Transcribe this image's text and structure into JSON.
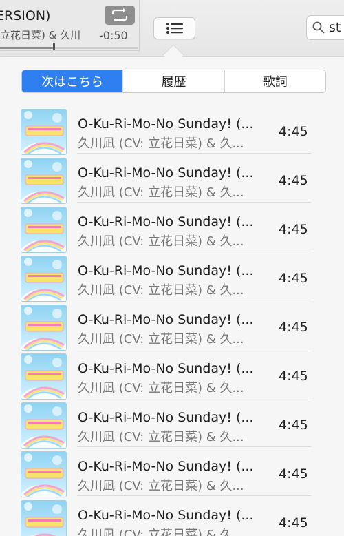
{
  "now_playing": {
    "title": "ERSION)",
    "artist": "立花日菜) & 久川",
    "remaining": "-0:50",
    "progress_fraction": 0.39
  },
  "search": {
    "value": "st"
  },
  "tabs": [
    {
      "label": "次はこちら",
      "active": true
    },
    {
      "label": "履歴",
      "active": false
    },
    {
      "label": "歌詞",
      "active": false
    }
  ],
  "tracks": [
    {
      "title": "O-Ku-Ri-Mo-No Sunday! (...",
      "artist": "久川凪 (CV: 立花日菜) & 久...",
      "duration": "4:45"
    },
    {
      "title": "O-Ku-Ri-Mo-No Sunday! (...",
      "artist": "久川凪 (CV: 立花日菜) & 久...",
      "duration": "4:45"
    },
    {
      "title": "O-Ku-Ri-Mo-No Sunday! (...",
      "artist": "久川凪 (CV: 立花日菜) & 久...",
      "duration": "4:45"
    },
    {
      "title": "O-Ku-Ri-Mo-No Sunday! (...",
      "artist": "久川凪 (CV: 立花日菜) & 久...",
      "duration": "4:45"
    },
    {
      "title": "O-Ku-Ri-Mo-No Sunday! (...",
      "artist": "久川凪 (CV: 立花日菜) & 久...",
      "duration": "4:45"
    },
    {
      "title": "O-Ku-Ri-Mo-No Sunday! (...",
      "artist": "久川凪 (CV: 立花日菜) & 久...",
      "duration": "4:45"
    },
    {
      "title": "O-Ku-Ri-Mo-No Sunday! (...",
      "artist": "久川凪 (CV: 立花日菜) & 久...",
      "duration": "4:45"
    },
    {
      "title": "O-Ku-Ri-Mo-No Sunday! (...",
      "artist": "久川凪 (CV: 立花日菜) & 久...",
      "duration": "4:45"
    },
    {
      "title": "O-Ku-Ri-Mo-No Sunday! (...",
      "artist": "久川凪 (CV: 立花日菜) & 久...",
      "duration": "4:45"
    }
  ],
  "icons": {
    "repeat": "repeat-icon",
    "up_next_list": "list-icon",
    "search": "search-icon",
    "artwork": "album-artwork"
  },
  "colors": {
    "accent": "#2f7ff0",
    "repeat_button": "#8e8e8e"
  }
}
